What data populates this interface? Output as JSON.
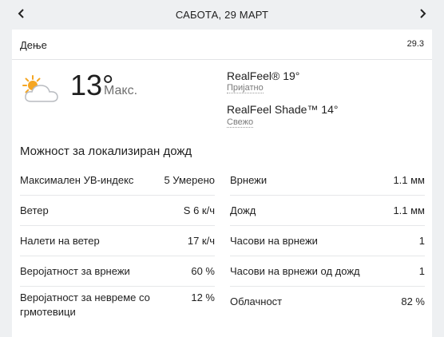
{
  "header": {
    "date_title": "САБОТА, 29 МАРТ",
    "prev_icon": "chevron-left-icon",
    "next_icon": "chevron-right-icon"
  },
  "card": {
    "period_label": "Дење",
    "period_date": "29.3",
    "weather_icon": "partly-cloudy-sun-icon",
    "temperature": "13°",
    "temperature_label": "Макс.",
    "realfeel": {
      "label": "RealFeel® 19°",
      "description": "Пријатно"
    },
    "realfeel_shade": {
      "label": "RealFeel Shade™ 14°",
      "description": "Свежо"
    },
    "section_title": "Можност за локализиран дожд",
    "left_stats": [
      {
        "label": "Максимален УВ-индекс",
        "value": "5 Умерено"
      },
      {
        "label": "Ветер",
        "value": "S 6 к/ч"
      },
      {
        "label": "Налети на ветер",
        "value": "17 к/ч"
      },
      {
        "label": "Веројатност за врнежи",
        "value": "60 %"
      },
      {
        "label": "Веројатност за невреме со грмотевици",
        "value": "12 %"
      }
    ],
    "right_stats": [
      {
        "label": "Врнежи",
        "value": "1.1 мм"
      },
      {
        "label": "Дожд",
        "value": "1.1 мм"
      },
      {
        "label": "Часови на врнежи",
        "value": "1"
      },
      {
        "label": "Часови на врнежи од дожд",
        "value": "1"
      },
      {
        "label": "Облачност",
        "value": "82 %"
      }
    ]
  },
  "colors": {
    "page_background": "#eef0f2",
    "card_background": "#ffffff",
    "sun": "#f5a623",
    "cloud": "#c9ccd0",
    "muted_text": "#6f6f6f"
  }
}
